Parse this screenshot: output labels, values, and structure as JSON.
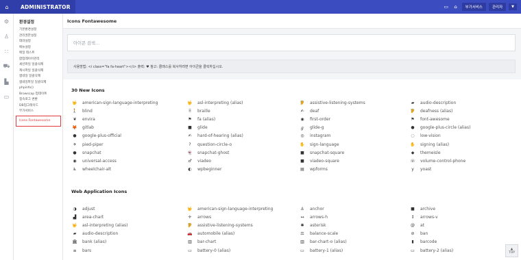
{
  "brand": {
    "title": "ADMINISTRATOR",
    "icon": "home-icon"
  },
  "topbar": {
    "icons": [
      "monitor-icon",
      "home-outline-icon"
    ],
    "extra_service_label": "부가서비스",
    "admin_label": "관리자",
    "toggle_label": "▼"
  },
  "rail": {
    "icons": [
      "gear-icon",
      "user-icon",
      "grid-icon",
      "cart-icon",
      "chart-icon",
      "card-icon"
    ]
  },
  "menu": {
    "title": "환경설정",
    "items": [
      "기본환경설정",
      "관리권한설정",
      "테마설정",
      "메뉴설정",
      "메일 테스트",
      "팝업레이어관리",
      "세션파일 일괄삭제",
      "캐시파일 일괄삭제",
      "썸네일 일괄삭제",
      "썸네일파일 일괄삭제",
      "phpinfo()",
      "Browscap 업데이트",
      "접속로그 변환",
      "DB업그레이드",
      "부가서비스"
    ],
    "active": "Icons Fontawesome"
  },
  "page": {
    "title": "Icons Fontawesome"
  },
  "search": {
    "placeholder": "아이콘 검색..."
  },
  "usage": {
    "text": "사용방법: <i class=\"fa fa-heart\"></i> 출력: ♥ 참고: 클래스를 복사하려면 아이콘을 클릭하십시오."
  },
  "sections": [
    {
      "title": "30 New Icons",
      "icons": [
        {
          "glyph": "🤟",
          "name": "american-sign-language-interpreting"
        },
        {
          "glyph": "🤟",
          "name": "asl-interpreting (alias)"
        },
        {
          "glyph": "🦻",
          "name": "assistive-listening-systems"
        },
        {
          "glyph": "▰",
          "name": "audio-description"
        },
        {
          "glyph": "🚶",
          "name": "blind"
        },
        {
          "glyph": "⠿",
          "name": "braille"
        },
        {
          "glyph": "✍",
          "name": "deaf"
        },
        {
          "glyph": "🦻",
          "name": "deafness (alias)"
        },
        {
          "glyph": "❦",
          "name": "envira"
        },
        {
          "glyph": "⚑",
          "name": "fa (alias)"
        },
        {
          "glyph": "◉",
          "name": "first-order"
        },
        {
          "glyph": "⚑",
          "name": "font-awesome"
        },
        {
          "glyph": "🦊",
          "name": "gitlab"
        },
        {
          "glyph": "■",
          "name": "glide"
        },
        {
          "glyph": "ℊ",
          "name": "glide-g"
        },
        {
          "glyph": "●",
          "name": "google-plus-circle (alias)"
        },
        {
          "glyph": "●",
          "name": "google-plus-official"
        },
        {
          "glyph": "✍",
          "name": "hard-of-hearing (alias)"
        },
        {
          "glyph": "◎",
          "name": "instagram"
        },
        {
          "glyph": "◌",
          "name": "low-vision"
        },
        {
          "glyph": "✈",
          "name": "pied-piper"
        },
        {
          "glyph": "?",
          "name": "question-circle-o"
        },
        {
          "glyph": "✋",
          "name": "sign-language"
        },
        {
          "glyph": "✋",
          "name": "signing (alias)"
        },
        {
          "glyph": "●",
          "name": "snapchat"
        },
        {
          "glyph": "👻",
          "name": "snapchat-ghost"
        },
        {
          "glyph": "■",
          "name": "snapchat-square"
        },
        {
          "glyph": "◆",
          "name": "themeisle"
        },
        {
          "glyph": "◉",
          "name": "universal-access"
        },
        {
          "glyph": "♂",
          "name": "viadeo"
        },
        {
          "glyph": "■",
          "name": "viadeo-square"
        },
        {
          "glyph": "☏",
          "name": "volume-control-phone"
        },
        {
          "glyph": "♿",
          "name": "wheelchair-alt"
        },
        {
          "glyph": "◐",
          "name": "wpbeginner"
        },
        {
          "glyph": "▤",
          "name": "wpforms"
        },
        {
          "glyph": "y",
          "name": "yoast"
        }
      ]
    },
    {
      "title": "Web Application Icons",
      "icons": [
        {
          "glyph": "◑",
          "name": "adjust"
        },
        {
          "glyph": "🤟",
          "name": "american-sign-language-interpreting"
        },
        {
          "glyph": "⚓",
          "name": "anchor"
        },
        {
          "glyph": "■",
          "name": "archive"
        },
        {
          "glyph": "▟",
          "name": "area-chart"
        },
        {
          "glyph": "✛",
          "name": "arrows"
        },
        {
          "glyph": "↔",
          "name": "arrows-h"
        },
        {
          "glyph": "↕",
          "name": "arrows-v"
        },
        {
          "glyph": "🤟",
          "name": "asl-interpreting (alias)"
        },
        {
          "glyph": "🦻",
          "name": "assistive-listening-systems"
        },
        {
          "glyph": "✱",
          "name": "asterisk"
        },
        {
          "glyph": "@",
          "name": "at"
        },
        {
          "glyph": "▰",
          "name": "audio-description"
        },
        {
          "glyph": "🚗",
          "name": "automobile (alias)"
        },
        {
          "glyph": "⚖",
          "name": "balance-scale"
        },
        {
          "glyph": "⊘",
          "name": "ban"
        },
        {
          "glyph": "🏛",
          "name": "bank (alias)"
        },
        {
          "glyph": "▥",
          "name": "bar-chart"
        },
        {
          "glyph": "▥",
          "name": "bar-chart-o (alias)"
        },
        {
          "glyph": "▮",
          "name": "barcode"
        },
        {
          "glyph": "≡",
          "name": "bars"
        },
        {
          "glyph": "▭",
          "name": "battery-0 (alias)"
        },
        {
          "glyph": "▭",
          "name": "battery-1 (alias)"
        },
        {
          "glyph": "▭",
          "name": "battery-2 (alias)"
        }
      ]
    }
  ],
  "top_button": {
    "arrow": "▲",
    "label": "TOP"
  }
}
